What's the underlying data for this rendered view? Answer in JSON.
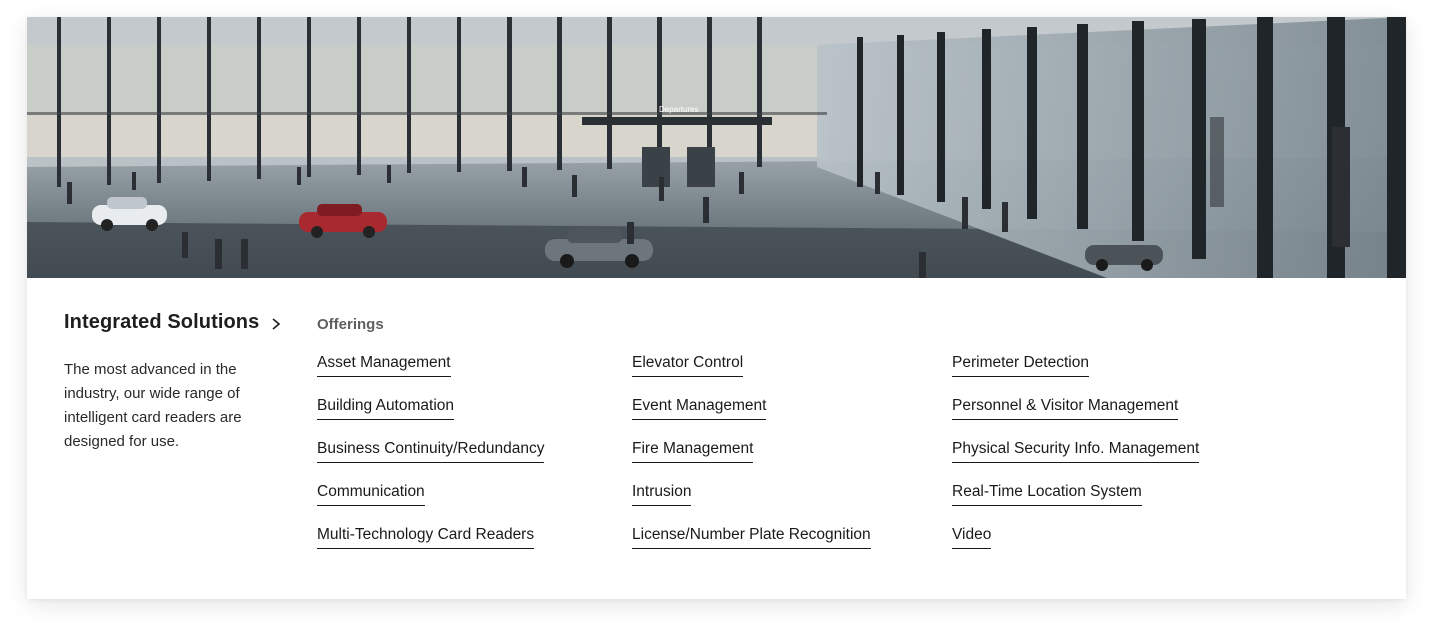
{
  "hero": {
    "image_description_icon": "airport-terminal-image",
    "sign_text": "Departures"
  },
  "panel": {
    "title": "Integrated Solutions",
    "chevron_icon": "chevron-right-icon",
    "description": "The most advanced in the industry, our wide range of intelligent card readers are designed for use."
  },
  "offerings": {
    "heading": "Offerings",
    "columns": [
      [
        "Asset Management",
        "Building Automation",
        "Business Continuity/Redundancy",
        "Communication",
        "Multi-Technology Card Readers"
      ],
      [
        "Elevator Control",
        "Event Management",
        "Fire Management",
        "Intrusion",
        "License/Number Plate Recognition"
      ],
      [
        "Perimeter Detection",
        "Personnel & Visitor Management",
        "Physical Security Info. Management",
        "Real-Time Location System",
        "Video"
      ]
    ]
  }
}
